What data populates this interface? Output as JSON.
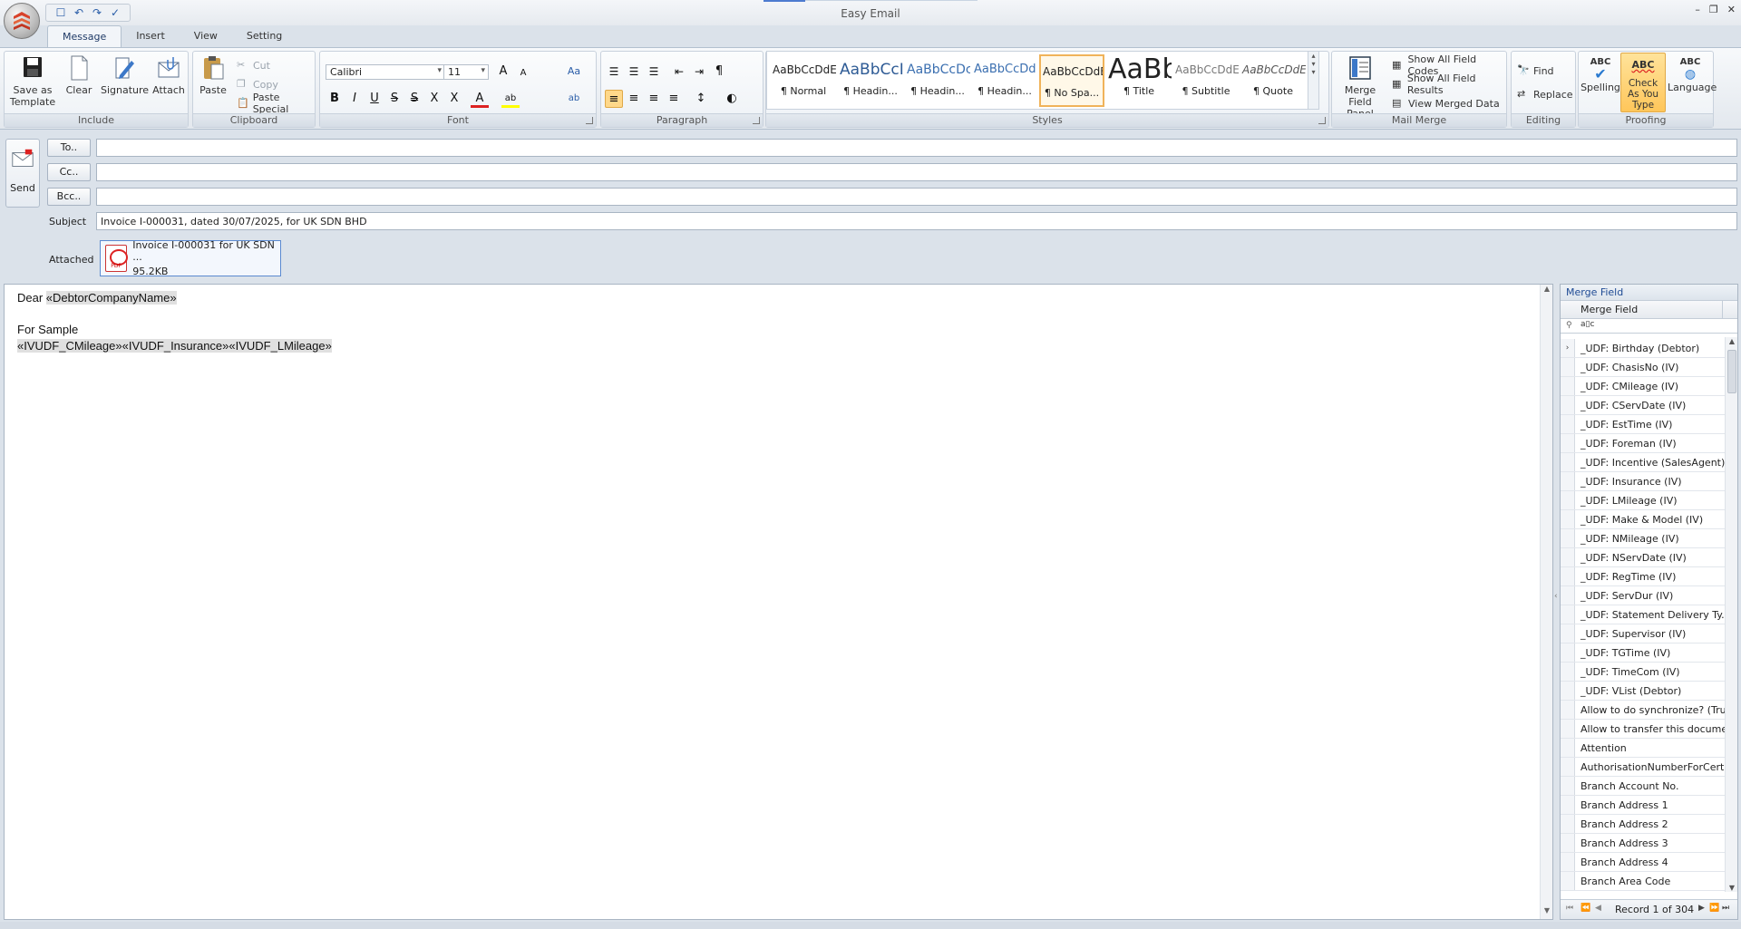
{
  "window": {
    "title": "Easy Email",
    "controls": {
      "minimize": "–",
      "restore": "❐",
      "close": "✕"
    }
  },
  "qat": {
    "new": "☐",
    "undo": "↶",
    "redo": "↷",
    "spell": "✓"
  },
  "tabs": [
    "Message",
    "Insert",
    "View",
    "Setting"
  ],
  "ribbon": {
    "include": {
      "label": "Include",
      "save_template": "Save as Template",
      "clear": "Clear",
      "signature": "Signature",
      "attach": "Attach"
    },
    "clipboard": {
      "label": "Clipboard",
      "paste": "Paste",
      "cut": "Cut",
      "copy": "Copy",
      "paste_special": "Paste Special"
    },
    "font": {
      "label": "Font",
      "family": "Calibri",
      "size": "11",
      "grow": "A",
      "shrink": "A",
      "change_case": "Aa",
      "bold": "B",
      "italic": "I",
      "underline": "U",
      "strike": "S",
      "double_strike": "S",
      "superscript": "X",
      "subscript": "X",
      "font_color": "A",
      "highlight": "ab",
      "clear_format": "ab"
    },
    "paragraph": {
      "label": "Paragraph",
      "bullets": "☰",
      "numbering": "☰",
      "multilevel": "☰",
      "outdent": "⇤",
      "indent": "⇥",
      "show_marks": "¶",
      "align_left": "≡",
      "align_center": "≡",
      "align_right": "≡",
      "justify": "≡",
      "line_spacing": "↕",
      "shading": "◐"
    },
    "styles": {
      "label": "Styles",
      "items": [
        {
          "sample": "AaBbCcDdE",
          "name": "¶ Normal"
        },
        {
          "sample": "AaBbCcI",
          "name": "¶ Headin..."
        },
        {
          "sample": "AaBbCcDc",
          "name": "¶ Headin..."
        },
        {
          "sample": "AaBbCcDd",
          "name": "¶ Headin..."
        },
        {
          "sample": "AaBbCcDdE",
          "name": "¶ No Spa..."
        },
        {
          "sample": "AaBb",
          "name": "¶ Title"
        },
        {
          "sample": "AaBbCcDdE",
          "name": "¶ Subtitle"
        },
        {
          "sample": "AaBbCcDdE",
          "name": "¶ Quote"
        }
      ]
    },
    "mail_merge": {
      "label": "Mail Merge",
      "panel": "Merge Field Panel",
      "show_codes": "Show All Field Codes",
      "show_results": "Show All Field Results",
      "view_merged": "View Merged Data"
    },
    "editing": {
      "label": "Editing",
      "find": "Find",
      "replace": "Replace"
    },
    "proofing": {
      "label": "Proofing",
      "spelling": "Spelling",
      "check_as_type": "Check As You Type",
      "language": "Language",
      "abc": "ABC"
    }
  },
  "compose": {
    "send": "Send",
    "to": "To..",
    "cc": "Cc..",
    "bcc": "Bcc..",
    "subject_label": "Subject",
    "subject": "Invoice I-000031, dated 30/07/2025, for UK SDN BHD",
    "attached_label": "Attached",
    "attachment": {
      "name": "Invoice I-000031 for UK SDN ...",
      "size": "95.2KB",
      "type": "PDF"
    }
  },
  "body": {
    "line1_prefix": "Dear ",
    "line1_field": "«DebtorCompanyName»",
    "line2": "For Sample",
    "line3_field1": "«IVUDF_CMileage»",
    "line3_field2": "«IVUDF_Insurance»",
    "line3_field3": "«IVUDF_LMileage»"
  },
  "merge_panel": {
    "title": "Merge Field",
    "column": "Merge Field",
    "filter_text": "a▯c",
    "fields": [
      "_UDF: Birthday (Debtor)",
      "_UDF: ChasisNo (IV)",
      "_UDF: CMileage (IV)",
      "_UDF: CServDate (IV)",
      "_UDF: EstTime (IV)",
      "_UDF: Foreman (IV)",
      "_UDF: Incentive (SalesAgent)",
      "_UDF: Insurance (IV)",
      "_UDF: LMileage (IV)",
      "_UDF: Make & Model (IV)",
      "_UDF: NMileage (IV)",
      "_UDF: NServDate (IV)",
      "_UDF: RegTime (IV)",
      "_UDF: ServDur (IV)",
      "_UDF: Statement Delivery Ty...",
      "_UDF: Supervisor (IV)",
      "_UDF: TGTime (IV)",
      "_UDF: TimeCom (IV)",
      "_UDF: VList (Debtor)",
      "Allow to do synchronize? (Tru...",
      "Allow to transfer this docume...",
      "Attention",
      "AuthorisationNumberForCerti...",
      "Branch Account No.",
      "Branch Address 1",
      "Branch Address 2",
      "Branch Address 3",
      "Branch Address 4",
      "Branch Area Code"
    ],
    "record_text": "Record 1 of 304"
  }
}
